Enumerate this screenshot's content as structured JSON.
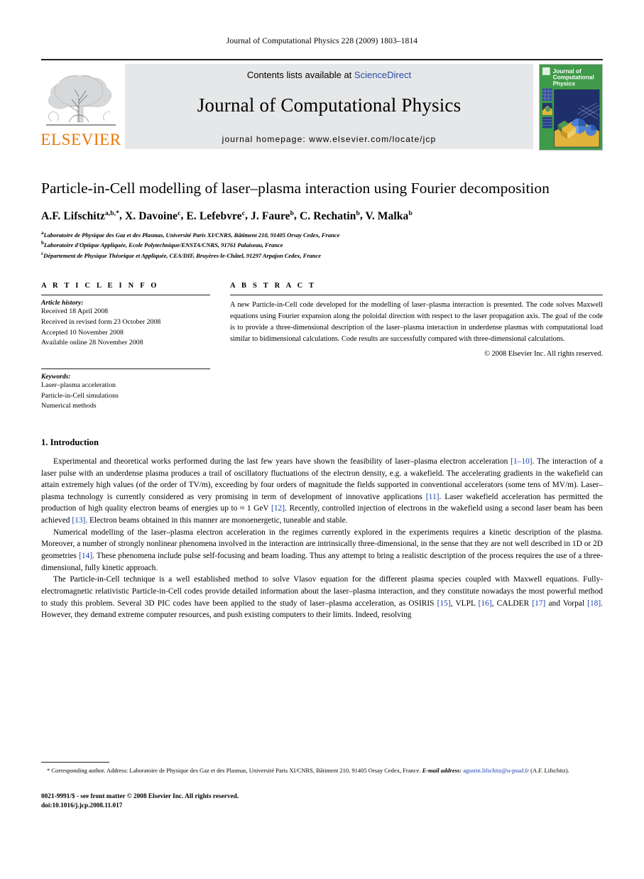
{
  "running_head": "Journal of Computational Physics 228 (2009) 1803–1814",
  "masthead": {
    "elsevier_wordmark": "ELSEVIER",
    "contents_prefix": "Contents lists available at ",
    "contents_link": "ScienceDirect",
    "journal_name": "Journal of Computational Physics",
    "homepage": "journal homepage: www.elsevier.com/locate/jcp",
    "cover_title_line1": "Journal of",
    "cover_title_line2": "Computational",
    "cover_title_line3": "Physics"
  },
  "title": "Particle-in-Cell modelling of laser–plasma interaction using Fourier decomposition",
  "authors": [
    {
      "name": "A.F. Lifschitz",
      "marks": "a,b,*"
    },
    {
      "name": "X. Davoine",
      "marks": "c"
    },
    {
      "name": "E. Lefebvre",
      "marks": "c"
    },
    {
      "name": "J. Faure",
      "marks": "b"
    },
    {
      "name": "C. Rechatin",
      "marks": "b"
    },
    {
      "name": "V. Malka",
      "marks": "b"
    }
  ],
  "affiliations": [
    {
      "mark": "a",
      "text": "Laboratoire de Physique des Gaz et des Plasmas, Université Paris XI/CNRS, Bâtiment 210, 91405 Orsay Cedex, France"
    },
    {
      "mark": "b",
      "text": "Laboratoire d'Optique Appliquée, Ecole Polytechnique/ENSTA/CNRS, 91761 Palaiseau, France"
    },
    {
      "mark": "c",
      "text": "Département de Physique Théorique et Appliquée, CEA/DIF, Bruyères-le-Châtel, 91297 Arpajon Cedex, France"
    }
  ],
  "article_info": {
    "heading": "A R T I C L E    I N F O",
    "history_label": "Article history:",
    "history": [
      "Received 18 April 2008",
      "Received in revised form 23 October 2008",
      "Accepted 10 November 2008",
      "Available online 28 November 2008"
    ],
    "keywords_label": "Keywords:",
    "keywords": [
      "Laser–plasma acceleration",
      "Particle-in-Cell simulations",
      "Numerical methods"
    ]
  },
  "abstract": {
    "heading": "A B S T R A C T",
    "text": "A new Particle-in-Cell code developed for the modelling of laser–plasma interaction is presented. The code solves Maxwell equations using Fourier expansion along the poloidal direction with respect to the laser propagation axis. The goal of the code is to provide a three-dimensional description of the laser–plasma interaction in underdense plasmas with computational load similar to bidimensional calculations. Code results are successfully compared with three-dimensional calculations.",
    "copyright": "© 2008 Elsevier Inc. All rights reserved."
  },
  "section": {
    "number_title": "1. Introduction",
    "paragraphs": [
      "Experimental and theoretical works performed during the last few years have shown the feasibility of laser–plasma electron acceleration [1–10]. The interaction of a laser pulse with an underdense plasma produces a trail of oscillatory fluctuations of the electron density, e.g. a wakefield. The accelerating gradients in the wakefield can attain extremely high values (of the order of TV/m), exceeding by four orders of magnitude the fields supported in conventional accelerators (some tens of MV/m). Laser–plasma technology is currently considered as very promising in term of development of innovative applications [11]. Laser wakefield acceleration has permitted the production of high quality electron beams of energies up to ≈ 1 GeV [12]. Recently, controlled injection of electrons in the wakefield using a second laser beam has been achieved [13]. Electron beams obtained in this manner are monoenergetic, tuneable and stable.",
      "Numerical modelling of the laser–plasma electron acceleration in the regimes currently explored in the experiments requires a kinetic description of the plasma. Moreover, a number of strongly nonlinear phenomena involved in the interaction are intrinsically three-dimensional, in the sense that they are not well described in 1D or 2D geometries [14]. These phenomena include pulse self-focusing and beam loading. Thus any attempt to bring a realistic description of the process requires the use of a three-dimensional, fully kinetic approach.",
      "The Particle-in-Cell technique is a well established method to solve Vlasov equation for the different plasma species coupled with Maxwell equations. Fully-electromagnetic relativistic Particle-in-Cell codes provide detailed information about the laser–plasma interaction, and they constitute nowadays the most powerful method to study this problem. Several 3D PIC codes have been applied to the study of laser–plasma acceleration, as OSIRIS [15], VLPL [16], CALDER [17] and Vorpal [18]. However, they demand extreme computer resources, and push existing computers to their limits. Indeed, resolving"
    ]
  },
  "footnotes": {
    "corresponding_star": "*",
    "corresponding_text": "Corresponding author. Address: Laboratoire de Physique des Gaz et des Plasmas, Université Paris XI/CNRS, Bâtiment 210, 91405 Orsay Cedex, France.",
    "email_label": "E-mail address:",
    "email": "agustin.lifschitz@u-psud.fr",
    "email_suffix": "(A.F. Lifschitz)."
  },
  "imprint": {
    "issn_line": "0021-9991/$ - see front matter © 2008 Elsevier Inc. All rights reserved.",
    "doi_line": "doi:10.1016/j.jcp.2008.11.017"
  },
  "colors": {
    "link_blue": "#2b49a8",
    "ref_blue": "#1a3faa",
    "elsevier_orange": "#ec7404",
    "cover_green": "#3f9a4a",
    "band_grey": "#e6e7e8"
  }
}
